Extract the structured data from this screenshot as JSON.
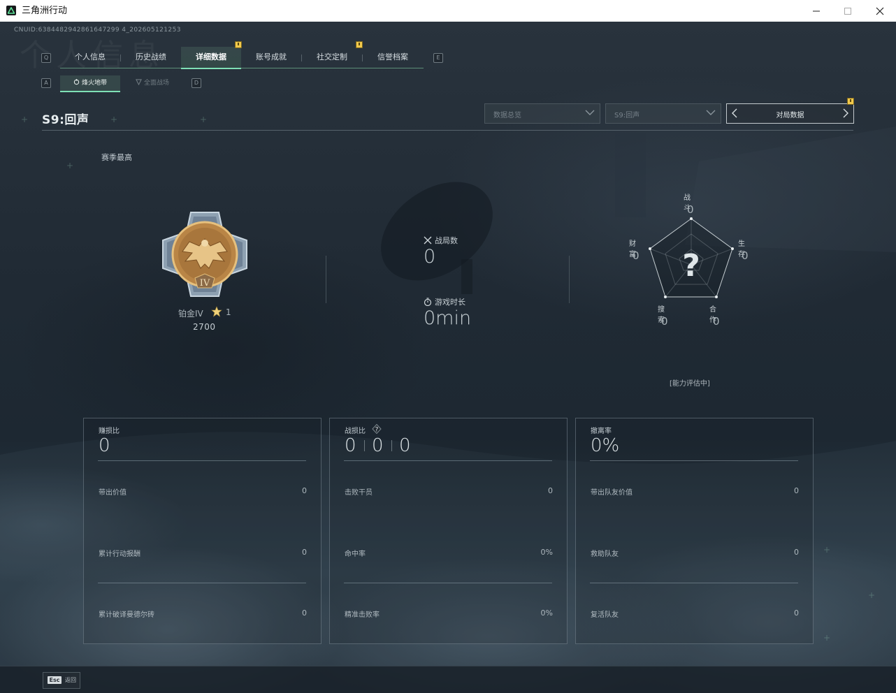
{
  "window": {
    "title": "三角洲行动"
  },
  "uid_text": "CNUID:6384482942861647299 4_202605121253",
  "watermark_text": "个人信息",
  "main_tabs": {
    "left_key": "Q",
    "right_key": "E",
    "items": [
      {
        "label": "个人信息",
        "active": false,
        "badge": false
      },
      {
        "label": "历史战绩",
        "active": false,
        "badge": false
      },
      {
        "label": "详细数据",
        "active": true,
        "badge": true
      },
      {
        "label": "账号成就",
        "active": false,
        "badge": false
      },
      {
        "label": "社交定制",
        "active": false,
        "badge": true
      },
      {
        "label": "信誉档案",
        "active": false,
        "badge": false
      }
    ]
  },
  "sub_tabs": {
    "left_key": "A",
    "right_key": "D",
    "items": [
      {
        "label": "烽火地带",
        "icon": "hazard-zone-icon",
        "active": true
      },
      {
        "label": "全面战场",
        "icon": "battlefield-icon",
        "active": false
      }
    ]
  },
  "season_title": "S9:回声",
  "filters": {
    "data_scope": "数据总览",
    "season": "S9:回声",
    "pager_label": "对局数据"
  },
  "season_best_label": "赛季最高",
  "rank": {
    "name": "铂金IV",
    "stars": "1",
    "score": "2700",
    "medal_numeral": "IV"
  },
  "summary": {
    "matches_label": "战局数",
    "matches_value": "0",
    "playtime_label": "游戏时长",
    "playtime_value": "0min"
  },
  "radar": {
    "unknown_mark": "?",
    "axes": [
      {
        "label": "战斗",
        "value": "0"
      },
      {
        "label": "生存",
        "value": "0"
      },
      {
        "label": "合作",
        "value": "0"
      },
      {
        "label": "搜索",
        "value": "0"
      },
      {
        "label": "财富",
        "value": "0"
      }
    ],
    "status": "[能力评估中]"
  },
  "cards": [
    {
      "title": "赚损比",
      "big": "0",
      "rows": [
        {
          "label": "带出价值",
          "value": "0"
        },
        {
          "label": "累计行动报酬",
          "value": "0"
        },
        {
          "label": "累计破译曼德尔砖",
          "value": "0"
        }
      ]
    },
    {
      "title": "战损比",
      "help": "?",
      "kd": [
        "0",
        "0",
        "0"
      ],
      "rows": [
        {
          "label": "击败干员",
          "value": "0"
        },
        {
          "label": "命中率",
          "value": "0%"
        },
        {
          "label": "精准击败率",
          "value": "0%"
        }
      ]
    },
    {
      "title": "撤离率",
      "big": "0%",
      "rows": [
        {
          "label": "带出队友价值",
          "value": "0"
        },
        {
          "label": "救助队友",
          "value": "0"
        },
        {
          "label": "复活队友",
          "value": "0"
        }
      ]
    }
  ],
  "footer": {
    "esc_key": "Esc",
    "esc_label": "返回"
  },
  "colors": {
    "accent_green": "#7fe0b6",
    "badge_yellow": "#f2c94c",
    "medal_gold": "#c9974f"
  }
}
